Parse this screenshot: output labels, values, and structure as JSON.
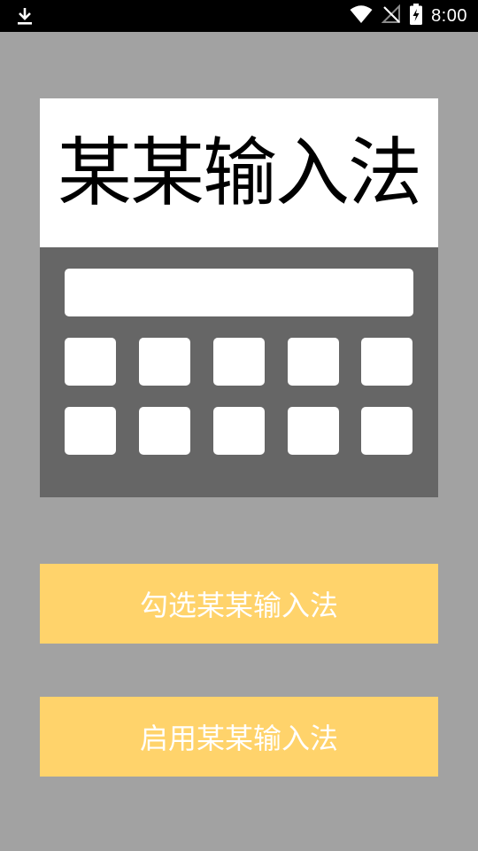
{
  "status_bar": {
    "time": "8:00",
    "icons": [
      "download-icon",
      "wifi-icon",
      "no-signal-icon",
      "battery-charging-icon"
    ]
  },
  "card": {
    "title": "某某输入法",
    "keyboard_rows": 2,
    "keys_per_row": 5
  },
  "buttons": {
    "select_label": "勾选某某输入法",
    "enable_label": "启用某某输入法"
  },
  "colors": {
    "background": "#a2a2a2",
    "keyboard": "#666666",
    "button": "#ffd36b",
    "button_text": "#ffffff"
  }
}
